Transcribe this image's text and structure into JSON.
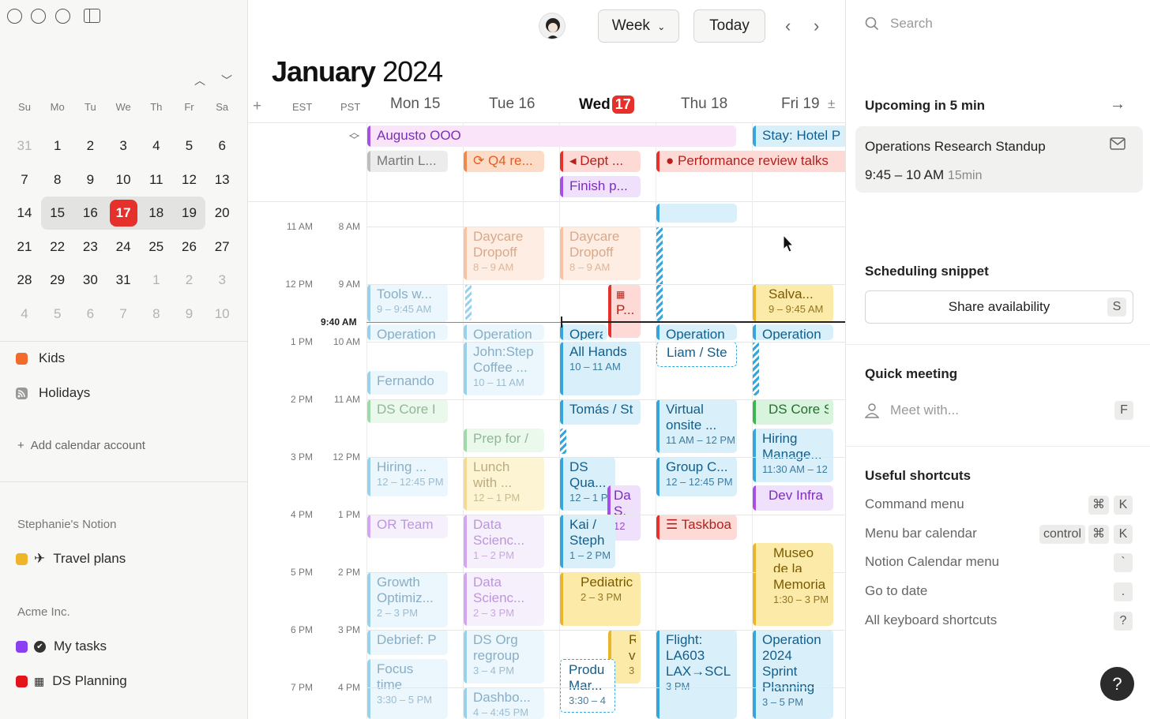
{
  "sidebar": {
    "mini_calendar": {
      "weekdays": [
        "Su",
        "Mo",
        "Tu",
        "We",
        "Th",
        "Fr",
        "Sa"
      ],
      "weeks": [
        [
          "31",
          "1",
          "2",
          "3",
          "4",
          "5",
          "6"
        ],
        [
          "7",
          "8",
          "9",
          "10",
          "11",
          "12",
          "13"
        ],
        [
          "14",
          "15",
          "16",
          "17",
          "18",
          "19",
          "20"
        ],
        [
          "21",
          "22",
          "23",
          "24",
          "25",
          "26",
          "27"
        ],
        [
          "28",
          "29",
          "30",
          "31",
          "1",
          "2",
          "3"
        ],
        [
          "4",
          "5",
          "6",
          "7",
          "8",
          "9",
          "10"
        ]
      ],
      "today": "17"
    },
    "calendars": [
      {
        "label": "Kids",
        "color": "#f26b2a"
      },
      {
        "label": "Holidays",
        "icon": "rss-icon"
      }
    ],
    "add_account": "Add calendar account",
    "notion_section": "Stephanie's Notion",
    "notion_items": [
      {
        "label": "Travel plans",
        "color": "#f0b429",
        "icon": "airplane-icon"
      }
    ],
    "acme_section": "Acme Inc.",
    "acme_items": [
      {
        "label": "My tasks",
        "color": "#8a3ff0",
        "icon": "check-circle-icon"
      },
      {
        "label": "DS Planning",
        "color": "#e3141b",
        "icon": "calendar-icon"
      }
    ]
  },
  "toolbar": {
    "view": "Week",
    "today": "Today"
  },
  "header": {
    "month": "January",
    "year": "2024",
    "tz_primary": "EST",
    "tz_secondary": "PST",
    "days": [
      {
        "name": "Mon",
        "num": "15"
      },
      {
        "name": "Tue",
        "num": "16"
      },
      {
        "name": "Wed",
        "num": "17"
      },
      {
        "name": "Thu",
        "num": "18"
      },
      {
        "name": "Fri",
        "num": "19"
      }
    ]
  },
  "time_labels": {
    "est": [
      "11 AM",
      "12 PM",
      "1 PM",
      "2 PM",
      "3 PM",
      "4 PM",
      "5 PM",
      "6 PM",
      "7 PM"
    ],
    "pst": [
      "8 AM",
      "9 AM",
      "10 AM",
      "11 AM",
      "12 PM",
      "1 PM",
      "2 PM",
      "3 PM",
      "4 PM"
    ],
    "now": "9:40 AM"
  },
  "events": {
    "allday": {
      "augusto": "Augusto OOO",
      "stay": "Stay: Hotel P",
      "martin": "Martin L...",
      "q4": "Q4 re...",
      "dept": "Dept ...",
      "perf": "Performance review talks",
      "finish": "Finish p..."
    },
    "mon": {
      "tools": {
        "t": "Tools w...",
        "s": "9 – 9:45 AM"
      },
      "operation": "Operation",
      "fernando": "Fernando",
      "dscore": "DS Core I",
      "hiring": {
        "t": "Hiring ...",
        "s": "12 – 12:45 PM"
      },
      "orteam": "OR Team",
      "growth": {
        "t1": "Growth",
        "t2": "Optimiz...",
        "s": "2 – 3 PM"
      },
      "debrief": "Debrief: P",
      "focus": {
        "t1": "Focus",
        "t2": "time",
        "s": "3:30 – 5 PM"
      }
    },
    "tue": {
      "daycare": {
        "t1": "Daycare",
        "t2": "Dropoff",
        "s": "8 – 9 AM"
      },
      "operation": "Operation",
      "john": {
        "t1": "John:Step",
        "t2": "Coffee ...",
        "s": "10 – 11 AM"
      },
      "prep": "Prep for /",
      "lunch": {
        "t1": "Lunch",
        "t2": "with ...",
        "s": "12 – 1 PM"
      },
      "data1": {
        "t1": "Data",
        "t2": "Scienc...",
        "s": "1 – 2 PM"
      },
      "data2": {
        "t1": "Data",
        "t2": "Scienc...",
        "s": "2 – 3 PM"
      },
      "dsorg": {
        "t1": "DS Org",
        "t2": "regroup",
        "s": "3 – 4 PM"
      },
      "dashbo": {
        "t": "Dashbo...",
        "s": "4 – 4:45 PM"
      }
    },
    "wed": {
      "daycare": {
        "t1": "Daycare",
        "t2": "Dropoff",
        "s": "8 – 9 AM"
      },
      "p": "P...",
      "opera": "Opera",
      "allhands": {
        "t": "All Hands",
        "s": "10 – 11 AM"
      },
      "tomas": "Tomás / St",
      "dsqua": {
        "t1": "DS",
        "t2": "Qua...",
        "s": "12 – 1 P"
      },
      "ds": {
        "t1": "Da",
        "t2": "S.",
        "s": "12"
      },
      "kai": {
        "t1": "Kai /",
        "t2": "Steph",
        "s": "1 – 2 PM"
      },
      "pediatric": {
        "t": "Pediatric",
        "s": "2 – 3 PM"
      },
      "rv": {
        "t1": "R",
        "t2": "v",
        "s": "3"
      },
      "produ": {
        "t1": "Produ",
        "t2": "Mar...",
        "s": "3:30 – 4"
      }
    },
    "thu": {
      "operation": "Operation",
      "liam": "Liam / Ste",
      "virtual": {
        "t1": "Virtual",
        "t2": "onsite ...",
        "s": "11 AM – 12 PM"
      },
      "group": {
        "t": "Group C...",
        "s": "12 – 12:45 PM"
      },
      "taskboa": "Taskboa",
      "flight": {
        "t1": "Flight:",
        "t2": "LA603",
        "t3": "LAX→SCL",
        "s": "3 PM"
      }
    },
    "fri": {
      "salva": {
        "t": "Salva...",
        "s": "9 – 9:45 AM"
      },
      "operation": "Operation",
      "dscore": "DS Core S",
      "hiring": {
        "t1": "Hiring",
        "t2": "Manage...",
        "s": "11:30 AM – 12"
      },
      "devinfra": "Dev Infra",
      "museo": {
        "t1": "Museo",
        "t2": "de la",
        "t3": "Memoria",
        "s": "1:30 – 3 PM"
      },
      "op2024": {
        "t1": "Operation",
        "t2": "2024",
        "t3": "Sprint",
        "t4": "Planning",
        "s": "3 – 5 PM"
      }
    }
  },
  "right_panel": {
    "search_placeholder": "Search",
    "upcoming_title": "Upcoming in 5 min",
    "upcoming_event": "Operations Research Standup",
    "upcoming_time": "9:45 – 10 AM",
    "upcoming_duration": "15min",
    "snippet_title": "Scheduling snippet",
    "share_label": "Share availability",
    "share_key": "S",
    "quick_title": "Quick meeting",
    "meet_placeholder": "Meet with...",
    "meet_key": "F",
    "shortcuts_title": "Useful shortcuts",
    "shortcuts": [
      {
        "label": "Command menu",
        "keys": [
          "⌘",
          "K"
        ]
      },
      {
        "label": "Menu bar calendar",
        "keys": [
          "control",
          "⌘",
          "K"
        ]
      },
      {
        "label": "Notion Calendar menu",
        "keys": [
          "`"
        ]
      },
      {
        "label": "Go to date",
        "keys": [
          "."
        ]
      },
      {
        "label": "All keyboard shortcuts",
        "keys": [
          "?"
        ]
      }
    ],
    "help": "?"
  }
}
